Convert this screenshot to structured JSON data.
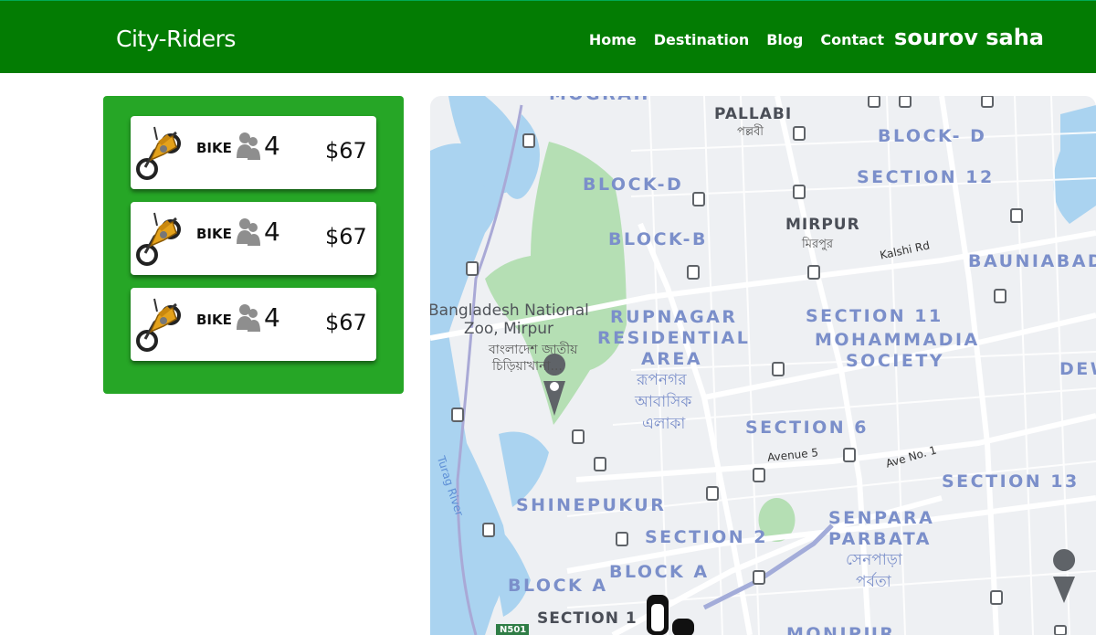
{
  "navbar": {
    "brand": "City-Riders",
    "links": [
      "Home",
      "Destination",
      "Blog",
      "Contact"
    ],
    "user": "sourov saha",
    "color": "#037c03"
  },
  "rides": [
    {
      "type": "BIKE",
      "passengers": "4",
      "price": "$67"
    },
    {
      "type": "BIKE",
      "passengers": "4",
      "price": "$67"
    },
    {
      "type": "BIKE",
      "passengers": "4",
      "price": "$67"
    }
  ],
  "panel_color": "#26a626",
  "map": {
    "areas": [
      "PALLABI",
      "BLOCK- D",
      "SECTION 12",
      "BLOCK-D",
      "MIRPUR",
      "BLOCK-B",
      "BAUNIABAD",
      "RUPNAGAR",
      "RESIDENTIAL",
      "AREA",
      "SECTION 11",
      "MOHAMMADIA",
      "SOCIETY",
      "DEW",
      "SECTION 6",
      "SECTION 13",
      "SHINEPUKUR",
      "SECTION 2",
      "SENPARA",
      "PARBATA",
      "BLOCK A",
      "BLOCK A",
      "SECTION 1",
      "MONIPUR"
    ],
    "bangla": [
      "পল্লবী",
      "মিরপুর",
      "রূপনগর",
      "আবাসিক",
      "এলাকা",
      "সেনপাড়া",
      "পর্বতা",
      "বাংলাদেশ জাতীয়",
      "চিড়িয়াখানা..."
    ],
    "roads": [
      "Kalshi Rd",
      "Avenue 5",
      "Ave No. 1",
      "N501"
    ],
    "zoo": [
      "Bangladesh National",
      "Zoo, Mirpur"
    ],
    "river": "Turag River",
    "top_partial": "MOGRAH"
  }
}
